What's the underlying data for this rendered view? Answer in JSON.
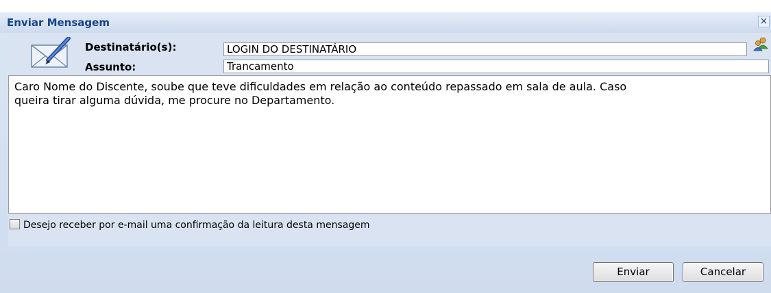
{
  "window": {
    "title": "Enviar Mensagem",
    "close_icon": "close-icon"
  },
  "form": {
    "recipients_label": "Destinatário(s):",
    "recipients_value": "LOGIN DO DESTINATÁRIO",
    "subject_label": "Assunto:",
    "subject_value": "Trancamento",
    "message": "Caro Nome do Discente, soube que teve dificuldades em relação ao conteúdo repassado em sala de aula. Caso\nqueira tirar alguma dúvida, me procure no Departamento.",
    "read_receipt_label": "Desejo receber por e-mail uma confirmação da leitura desta mensagem",
    "read_receipt_checked": false
  },
  "buttons": {
    "send": "Enviar",
    "cancel": "Cancelar"
  },
  "icons": {
    "compose": "compose-mail-icon",
    "contacts": "contacts-icon"
  },
  "colors": {
    "title_text": "#15428b",
    "panel_bg": "#d9e3f1"
  }
}
